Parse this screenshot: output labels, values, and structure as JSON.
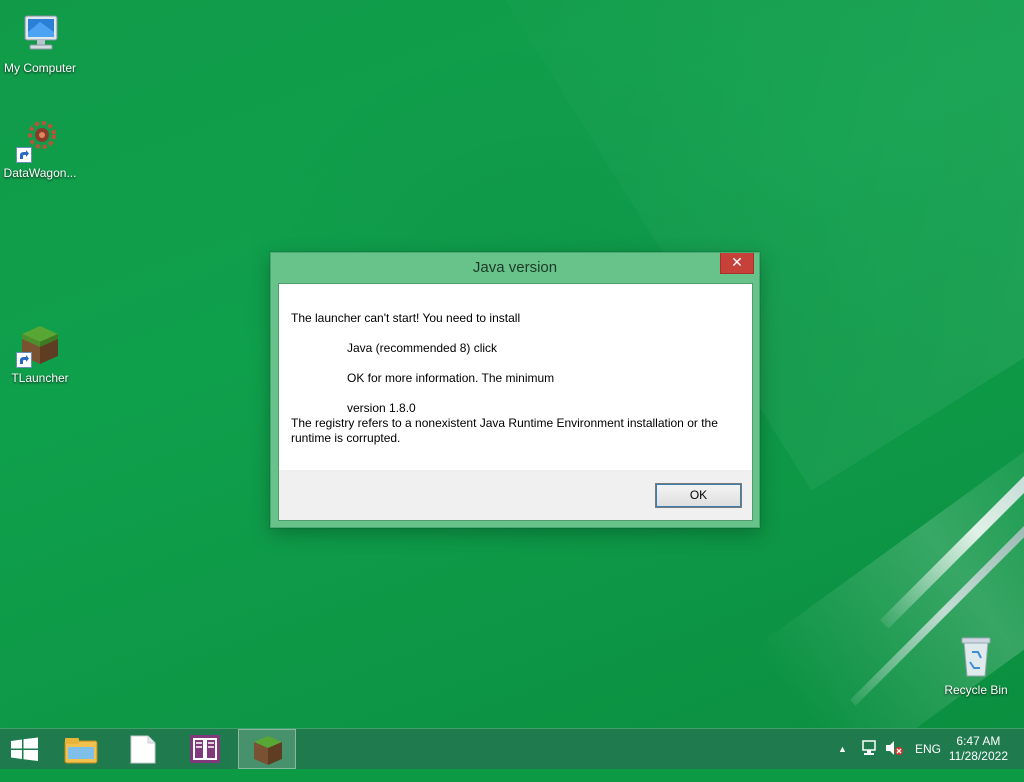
{
  "desktop": {
    "icons": [
      {
        "label": "My Computer",
        "icon": "computer-icon"
      },
      {
        "label": "DataWagon...",
        "icon": "gear-icon"
      },
      {
        "label": "TLauncher",
        "icon": "grass-block-icon"
      },
      {
        "label": "Recycle Bin",
        "icon": "recycle-bin-icon"
      }
    ]
  },
  "dialog": {
    "title": "Java version",
    "close_symbol": "✕",
    "lines": [
      "The launcher can't start! You need to install",
      "Java (recommended 8) click",
      "OK for more information. The minimum",
      "version 1.8.0",
      "The registry refers to a nonexistent Java Runtime Environment installation or the runtime is corrupted."
    ],
    "ok_label": "OK"
  },
  "taskbar": {
    "items": [
      "windows-start-icon",
      "file-explorer-icon",
      "notepad-icon",
      "onenote-icon",
      "tlauncher-icon"
    ],
    "tray": {
      "chevron": "▲",
      "language": "ENG",
      "time": "6:47 AM",
      "date": "11/28/2022"
    }
  },
  "colors": {
    "desktop_green": "#0f9c49",
    "dialog_frame": "#67c38a",
    "close_red": "#c7413b",
    "taskbar": "#1f7a4d"
  }
}
